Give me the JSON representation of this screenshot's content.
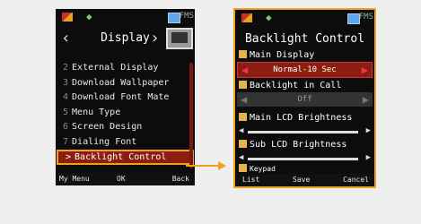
{
  "left_screen": {
    "title": "Display",
    "fms": "FMS",
    "items": [
      {
        "num": "2",
        "label": "External Display"
      },
      {
        "num": "3",
        "label": "Download Wallpaper"
      },
      {
        "num": "4",
        "label": "Download Font Mate"
      },
      {
        "num": "5",
        "label": "Menu Type"
      },
      {
        "num": "6",
        "label": "Screen Design"
      },
      {
        "num": "7",
        "label": "Dialing Font"
      },
      {
        "num": ">",
        "label": "Backlight Control"
      }
    ],
    "soft_left": "My Menu",
    "soft_center": "OK",
    "soft_right": "Back"
  },
  "right_screen": {
    "title": "Backlight Control",
    "fms": "FMS",
    "main_display_label": "Main Display",
    "main_display_value": "Normal-10 Sec",
    "backlight_call_label": "Backlight in Call",
    "backlight_call_value": "Off",
    "main_lcd_label": "Main LCD Brightness",
    "sub_lcd_label": "Sub LCD Brightness",
    "keypad_label": "Keypad",
    "soft_left": "List",
    "soft_center": "Save",
    "soft_right": "Cancel"
  },
  "colors": {
    "highlight": "#f0a020",
    "selected_bg": "#8b1e10"
  }
}
